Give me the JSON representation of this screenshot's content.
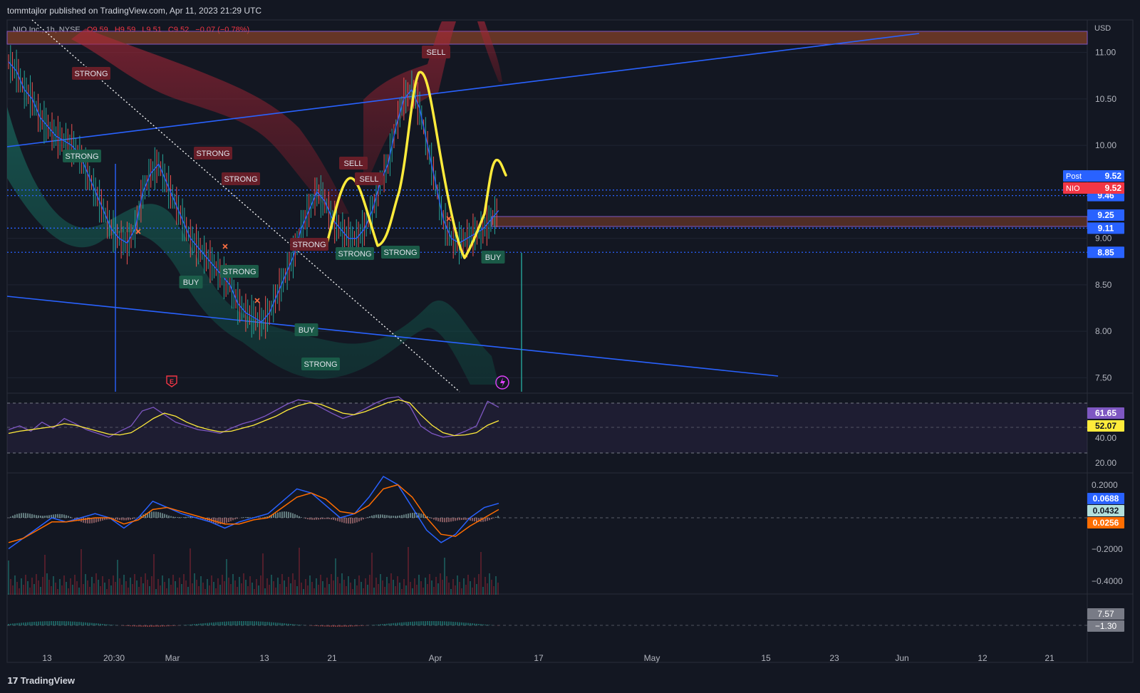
{
  "header": {
    "published": "tommtajlor published on TradingView.com, Apr 11, 2023 21:29 UTC"
  },
  "symbol": {
    "name": "NIO Inc., 1h, NYSE",
    "open": "O9.59",
    "high": "H9.59",
    "low": "L9.51",
    "close": "C9.52",
    "change": "−0.07 (−0.78%)"
  },
  "currency": "USD",
  "footer": {
    "brand": "TradingView"
  },
  "colors": {
    "background": "#131722",
    "grid": "#1f2433",
    "trendline": "#2962ff",
    "highlight": "#ffeb3b",
    "bull": "#26a69a",
    "bear": "#ef5350",
    "red_band": "#b2283a",
    "green_band": "#1b7a6b",
    "rsi": "#7e57c2"
  },
  "chart_data": [
    {
      "type": "line",
      "panel": "price",
      "y_ticks": [
        "11.00",
        "10.50",
        "10.00",
        "9.00",
        "8.50",
        "8.00",
        "7.50"
      ],
      "ylim": [
        7.35,
        11.35
      ],
      "x_ticks": [
        "13",
        "20:30",
        "Mar",
        "13",
        "21",
        "Apr",
        "17",
        "May",
        "15",
        "23",
        "Jun",
        "12",
        "21"
      ],
      "series": [
        {
          "values": [
            10.9,
            10.8,
            10.6,
            10.5,
            10.3,
            10.2,
            10.1,
            10.05,
            10.0,
            9.9,
            9.7,
            9.5,
            9.3,
            9.1,
            9.0,
            8.95,
            9.1,
            9.5,
            9.7,
            9.8,
            9.6,
            9.4,
            9.2,
            9.0,
            8.9,
            8.8,
            8.7,
            8.6,
            8.5,
            8.3,
            8.2,
            8.15,
            8.1,
            8.2,
            8.4,
            8.6,
            8.8,
            9.1,
            9.3,
            9.5,
            9.4,
            9.2,
            9.1,
            9.0,
            9.0,
            9.1,
            9.3,
            9.6,
            9.8,
            10.2,
            10.5,
            10.6,
            10.4,
            10.0,
            9.6,
            9.2,
            9.0,
            8.95,
            9.0,
            9.05,
            9.1,
            9.2,
            9.3
          ]
        }
      ],
      "horizontal_levels": [
        9.52,
        9.46,
        9.11,
        8.85
      ],
      "axis_badges": [
        {
          "label": "9.52",
          "price": 9.52,
          "color": "#2962ff"
        },
        {
          "label": "9.46",
          "price": 9.46,
          "color": "#2962ff"
        },
        {
          "label": "9.25",
          "price": 9.25,
          "color": "#2962ff"
        },
        {
          "label": "9.11",
          "price": 9.11,
          "color": "#2962ff"
        },
        {
          "label": "8.85",
          "price": 8.85,
          "color": "#2962ff"
        }
      ],
      "tags": [
        {
          "label": "Post",
          "value": "9.52",
          "color": "#2962ff"
        },
        {
          "label": "NIO",
          "value": "9.52",
          "color": "#f23645"
        }
      ],
      "signals": [
        {
          "text": "STRONG",
          "kind": "bear"
        },
        {
          "text": "STRONG",
          "kind": "bull"
        },
        {
          "text": "STRONG",
          "kind": "bear"
        },
        {
          "text": "STRONG",
          "kind": "bear"
        },
        {
          "text": "BUY",
          "kind": "bull"
        },
        {
          "text": "STRONG",
          "kind": "bull"
        },
        {
          "text": "STRONG",
          "kind": "bear"
        },
        {
          "text": "BUY",
          "kind": "bull"
        },
        {
          "text": "STRONG",
          "kind": "bull"
        },
        {
          "text": "SELL",
          "kind": "bear"
        },
        {
          "text": "SELL",
          "kind": "bear"
        },
        {
          "text": "STRONG",
          "kind": "bull"
        },
        {
          "text": "STRONG",
          "kind": "bull"
        },
        {
          "text": "SELL",
          "kind": "bear"
        },
        {
          "text": "BUY",
          "kind": "bull"
        }
      ],
      "event_icons": [
        "E"
      ]
    },
    {
      "type": "line",
      "panel": "rsi",
      "y_ticks": [
        "40.00",
        "20.00"
      ],
      "ylim": [
        15,
        85
      ],
      "series": [
        {
          "values": [
            40,
            45,
            38,
            50,
            42,
            55,
            48,
            40,
            35,
            30,
            38,
            45,
            65,
            70,
            60,
            50,
            45,
            40,
            38,
            35,
            42,
            48,
            52,
            58,
            66,
            74,
            80,
            78,
            70,
            62,
            55,
            60,
            68,
            76,
            82,
            84,
            72,
            45,
            35,
            30,
            32,
            38,
            45,
            78,
            70
          ]
        },
        {
          "values": [
            35,
            38,
            40,
            42,
            44,
            48,
            46,
            42,
            38,
            34,
            33,
            36,
            45,
            55,
            62,
            58,
            50,
            44,
            40,
            37,
            38,
            42,
            46,
            52,
            58,
            66,
            72,
            76,
            74,
            68,
            62,
            60,
            64,
            70,
            76,
            80,
            76,
            60,
            46,
            36,
            32,
            33,
            36,
            46,
            52
          ]
        }
      ],
      "badges": [
        {
          "label": "61.65",
          "color": "#7e57c2"
        },
        {
          "label": "52.07",
          "color": "#ffeb3b"
        }
      ]
    },
    {
      "type": "line",
      "panel": "macd",
      "y_ticks": [
        "0.2000",
        "−0.2000",
        "−0.4000"
      ],
      "ylim": [
        -0.5,
        0.25
      ],
      "series": [
        {
          "values": [
            -0.15,
            -0.1,
            -0.05,
            0.0,
            -0.02,
            0.0,
            0.02,
            0.0,
            -0.05,
            0.0,
            0.08,
            0.05,
            0.02,
            0.0,
            -0.02,
            -0.05,
            -0.02,
            0.0,
            0.02,
            0.08,
            0.14,
            0.12,
            0.06,
            0.0,
            0.02,
            0.1,
            0.2,
            0.16,
            0.05,
            -0.06,
            -0.12,
            -0.08,
            0.0,
            0.05,
            0.07
          ]
        },
        {
          "values": [
            -0.12,
            -0.1,
            -0.06,
            -0.02,
            -0.02,
            -0.01,
            0.0,
            0.0,
            -0.03,
            -0.01,
            0.04,
            0.05,
            0.03,
            0.01,
            -0.01,
            -0.03,
            -0.03,
            -0.01,
            0.0,
            0.05,
            0.1,
            0.12,
            0.09,
            0.03,
            0.02,
            0.06,
            0.14,
            0.16,
            0.1,
            0.0,
            -0.08,
            -0.09,
            -0.04,
            0.0,
            0.04
          ]
        }
      ],
      "badges": [
        {
          "label": "0.0688",
          "color": "#2962ff"
        },
        {
          "label": "0.0432",
          "color": "#b2dfdb"
        },
        {
          "label": "0.0256",
          "color": "#ff6d00"
        }
      ]
    },
    {
      "type": "bar",
      "panel": "oscillator",
      "badges": [
        {
          "label": "7.57",
          "color": "#787b86"
        },
        {
          "label": "−1.30",
          "color": "#787b86"
        }
      ]
    }
  ]
}
